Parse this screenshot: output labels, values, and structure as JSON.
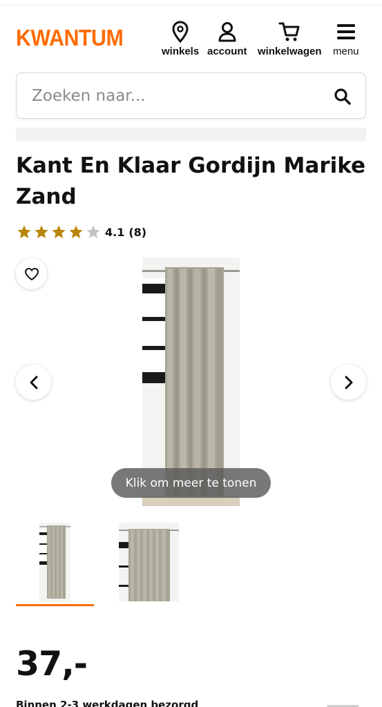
{
  "brand": {
    "logo_text": "KWANTUM",
    "accent_color": "#ff6b00"
  },
  "header": {
    "nav": [
      {
        "label": "winkels",
        "icon": "location-pin-icon"
      },
      {
        "label": "account",
        "icon": "user-icon"
      },
      {
        "label": "winkelwagen",
        "icon": "cart-icon"
      },
      {
        "label": "menu",
        "icon": "hamburger-icon"
      }
    ]
  },
  "search": {
    "placeholder": "Zoeken naar...",
    "value": "",
    "icon": "search-icon"
  },
  "product": {
    "title": "Kant En Klaar Gordijn Marike Zand",
    "rating_value": "4.1",
    "rating_count": "(8)",
    "rating_stars": 4.1,
    "price": "37,-",
    "delivery": "Binnen 2-3 werkdagen bezorgd"
  },
  "gallery": {
    "show_more_label": "Klik om meer te tonen",
    "thumbnail_count": 2,
    "active_thumbnail": 1
  }
}
